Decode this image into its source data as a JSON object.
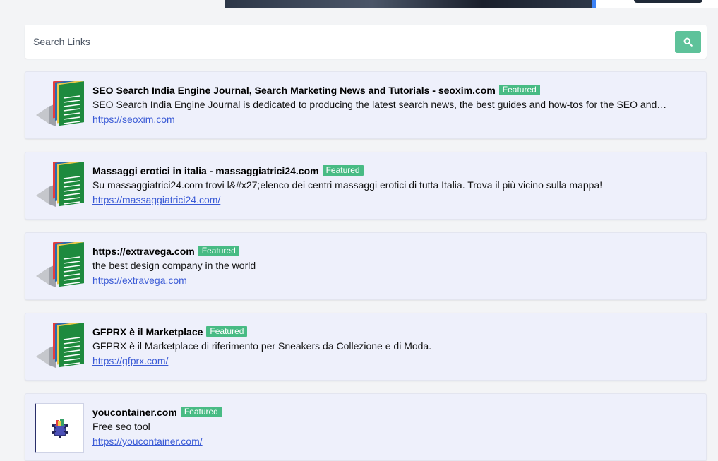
{
  "search": {
    "placeholder": "Search Links",
    "button_icon": "search-icon"
  },
  "colors": {
    "accent": "#5ec29a",
    "badge": "#48bb84",
    "card_bg": "#eef0fb",
    "link": "#3b5bd6"
  },
  "listings": [
    {
      "title": "SEO Search India Engine Journal, Search Marketing News and Tutorials - seoxim.com",
      "badge": "Featured",
      "description": "SEO Search India Engine Journal is dedicated to producing the latest search news, the best guides and how-tos for the SEO and…",
      "url": "https://seoxim.com",
      "thumb_icon": "document-stack-icon"
    },
    {
      "title": "Massaggi erotici in italia - massaggiatrici24.com",
      "badge": "Featured",
      "description": "Su massaggiatrici24.com trovi l&#x27;elenco dei centri massaggi erotici di tutta Italia. Trova il più vicino sulla mappa!",
      "url": "https://massaggiatrici24.com/",
      "thumb_icon": "document-stack-icon"
    },
    {
      "title": "https://extravega.com",
      "badge": "Featured",
      "description": "the best design company in the world",
      "url": "https://extravega.com",
      "thumb_icon": "document-stack-icon"
    },
    {
      "title": "GFPRX è il Marketplace",
      "badge": "Featured",
      "description": "GFPRX è il Marketplace di riferimento per Sneakers da Collezione e di Moda.",
      "url": "https://gfprx.com/",
      "thumb_icon": "document-stack-icon"
    },
    {
      "title": "youcontainer.com",
      "badge": "Featured",
      "description": "Free seo tool",
      "url": "https://youcontainer.com/",
      "thumb_icon": "site-logo-icon"
    }
  ]
}
